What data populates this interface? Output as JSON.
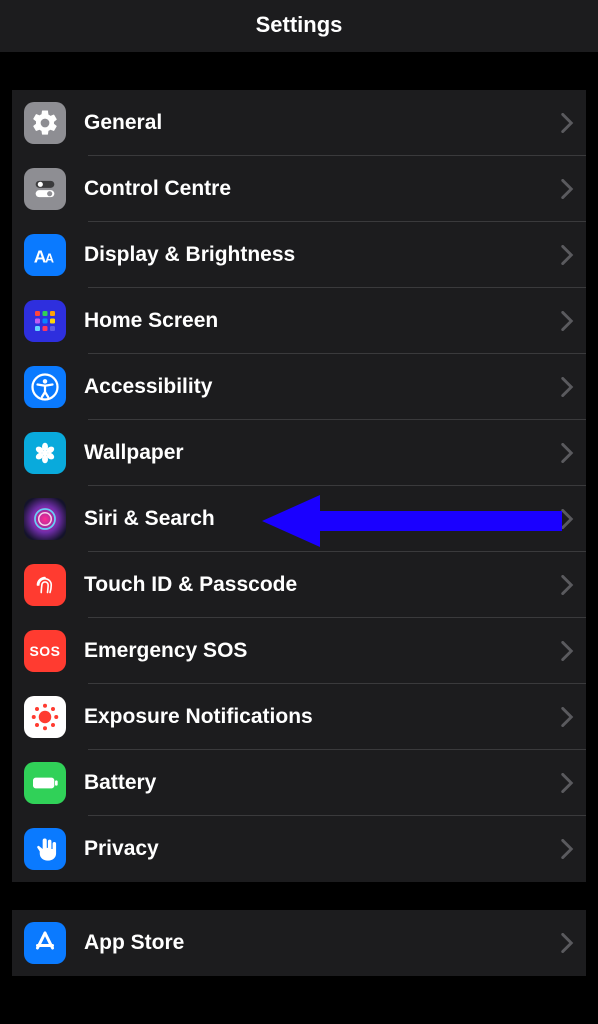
{
  "header": {
    "title": "Settings"
  },
  "groups": [
    {
      "items": [
        {
          "id": "general",
          "label": "General"
        },
        {
          "id": "control-centre",
          "label": "Control Centre"
        },
        {
          "id": "display-brightness",
          "label": "Display & Brightness"
        },
        {
          "id": "home-screen",
          "label": "Home Screen"
        },
        {
          "id": "accessibility",
          "label": "Accessibility"
        },
        {
          "id": "wallpaper",
          "label": "Wallpaper"
        },
        {
          "id": "siri-search",
          "label": "Siri & Search"
        },
        {
          "id": "touch-id-passcode",
          "label": "Touch ID & Passcode"
        },
        {
          "id": "emergency-sos",
          "label": "Emergency SOS"
        },
        {
          "id": "exposure-notifications",
          "label": "Exposure Notifications"
        },
        {
          "id": "battery",
          "label": "Battery"
        },
        {
          "id": "privacy",
          "label": "Privacy"
        }
      ]
    },
    {
      "items": [
        {
          "id": "app-store",
          "label": "App Store"
        }
      ]
    }
  ],
  "annotation": {
    "target_id": "siri-search",
    "color": "#1a00ff"
  }
}
